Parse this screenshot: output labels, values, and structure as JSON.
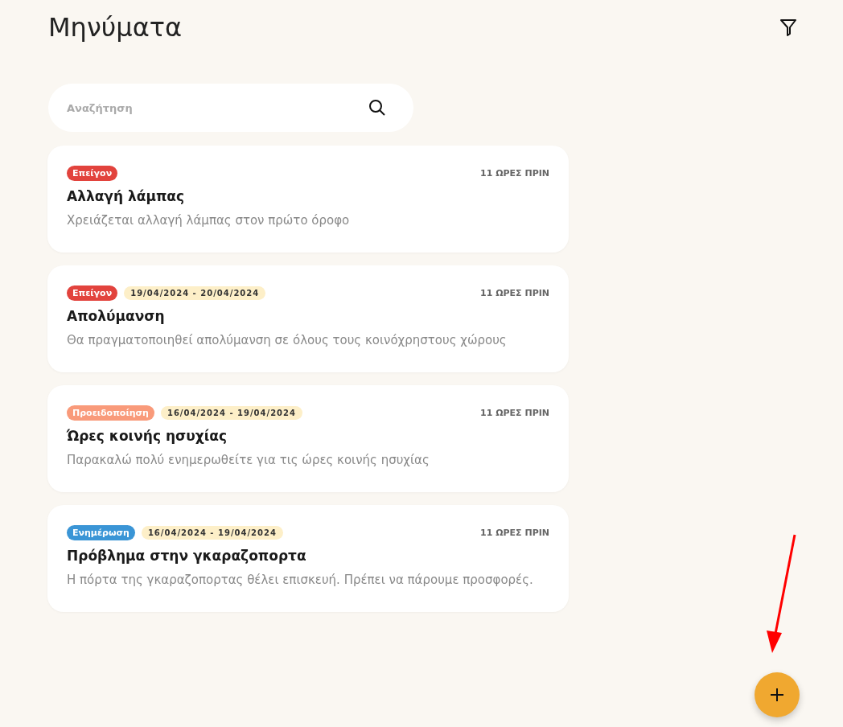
{
  "title": "Μηνύματα",
  "search": {
    "placeholder": "Αναζήτηση"
  },
  "messages": [
    {
      "tag": {
        "label": "Επείγον",
        "color": "#e2433d"
      },
      "time": "11 ΩΡΕΣ ΠΡΙΝ",
      "title": "Αλλαγή λάμπας",
      "body": "Χρειάζεται αλλαγή λάμπας στον πρώτο όροφο"
    },
    {
      "tag": {
        "label": "Επείγον",
        "color": "#e2433d"
      },
      "dates": "19/04/2024 - 20/04/2024",
      "time": "11 ΩΡΕΣ ΠΡΙΝ",
      "title": "Απολύμανση",
      "body": "Θα πραγματοποιηθεί απολύμανση σε όλους τους κοινόχρηστους χώρους"
    },
    {
      "tag": {
        "label": "Προειδοποίηση",
        "color": "#f99a7a"
      },
      "dates": "16/04/2024 - 19/04/2024",
      "time": "11 ΩΡΕΣ ΠΡΙΝ",
      "title": "Ώρες κοινής ησυχίας",
      "body": "Παρακαλώ πολύ ενημερωθείτε για τις ώρες κοινής ησυχίας"
    },
    {
      "tag": {
        "label": "Ενημέρωση",
        "color": "#3a95d6"
      },
      "dates": "16/04/2024 - 19/04/2024",
      "time": "11 ΩΡΕΣ ΠΡΙΝ",
      "title": "Πρόβλημα στην γκαραζοπορτα",
      "body": "Η πόρτα της γκαραζοπορτας θέλει επισκευή. Πρέπει να πάρουμε προσφορές."
    }
  ]
}
